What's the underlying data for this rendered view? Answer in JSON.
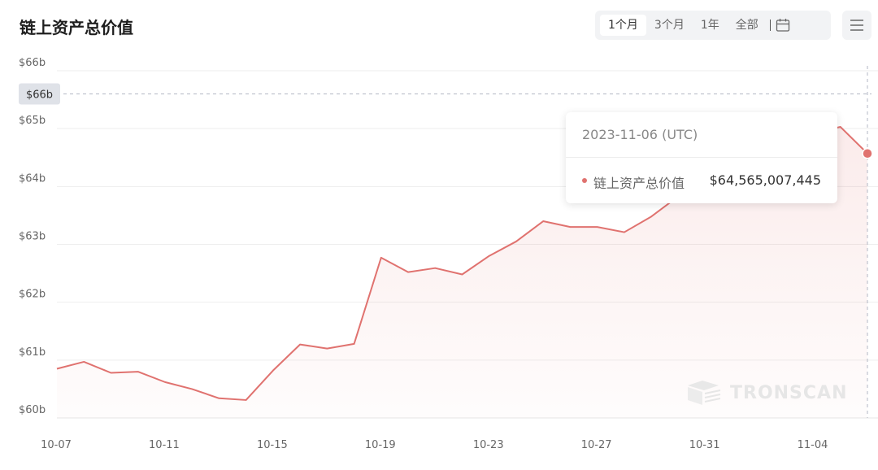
{
  "header": {
    "title": "链上资产总价值"
  },
  "range_buttons": [
    {
      "label": "1个月",
      "active": true
    },
    {
      "label": "3个月",
      "active": false
    },
    {
      "label": "1年",
      "active": false
    },
    {
      "label": "全部",
      "active": false
    }
  ],
  "icons": {
    "calendar": "calendar-icon",
    "menu": "hamburger-menu-icon"
  },
  "colors": {
    "line": "#e0726f",
    "area": "#fdeeee"
  },
  "crosshair": {
    "label": "$66b",
    "value_b": 65.6
  },
  "tooltip": {
    "date": "2023-11-06 (UTC)",
    "series_label": "链上资产总价值",
    "value": "$64,565,007,445"
  },
  "watermark": {
    "text": "TRONSCAN"
  },
  "chart_data": {
    "type": "area",
    "title": "链上资产总价值",
    "ylim": [
      60,
      66
    ],
    "y_ticks": [
      "$60b",
      "$61b",
      "$62b",
      "$63b",
      "$64b",
      "$65b",
      "$66b"
    ],
    "x_tick_labels": [
      "10-07",
      "10-11",
      "10-15",
      "10-19",
      "10-23",
      "10-27",
      "10-31",
      "11-04"
    ],
    "grid": true,
    "series": [
      {
        "name": "链上资产总价值",
        "x": [
          "10-07",
          "10-08",
          "10-09",
          "10-10",
          "10-11",
          "10-12",
          "10-13",
          "10-14",
          "10-15",
          "10-16",
          "10-17",
          "10-18",
          "10-19",
          "10-20",
          "10-21",
          "10-22",
          "10-23",
          "10-24",
          "10-25",
          "10-26",
          "10-27",
          "10-28",
          "10-29",
          "10-30",
          "10-31",
          "11-01",
          "11-02",
          "11-03",
          "11-04",
          "11-05",
          "11-06"
        ],
        "values": [
          60.85,
          60.97,
          60.78,
          60.8,
          60.62,
          60.5,
          60.34,
          60.31,
          60.82,
          61.27,
          61.2,
          61.28,
          62.77,
          62.52,
          62.59,
          62.48,
          62.8,
          63.05,
          63.4,
          63.3,
          63.3,
          63.21,
          63.48,
          63.83,
          64.1,
          64.3,
          64.5,
          64.7,
          64.92,
          65.03,
          64.57
        ]
      }
    ]
  }
}
